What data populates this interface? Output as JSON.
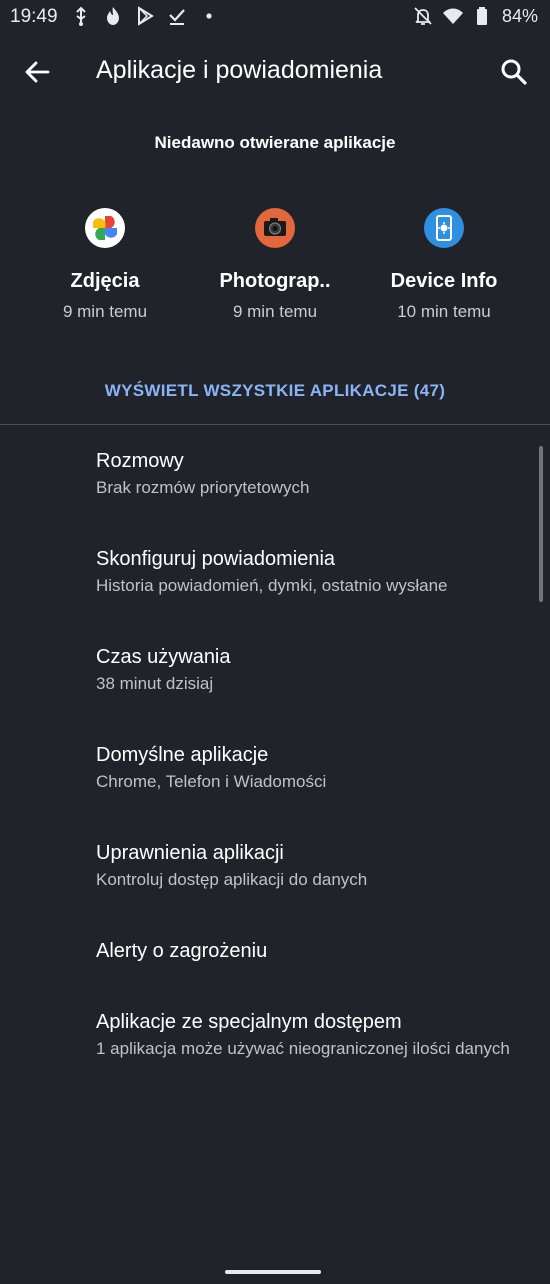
{
  "status_bar": {
    "time": "19:49",
    "battery": "84%",
    "left_icons": [
      "usb-debug-icon",
      "fire-icon",
      "play-store-icon",
      "download-check-icon",
      "dot-icon"
    ],
    "right_icons": [
      "notifications-off-icon",
      "wifi-icon",
      "battery-icon"
    ]
  },
  "app_bar": {
    "title": "Aplikacje i powiadomienia",
    "back_icon": "arrow-back-icon",
    "search_icon": "search-icon"
  },
  "recent": {
    "title": "Niedawno otwierane aplikacje",
    "apps": [
      {
        "name": "Zdjęcia",
        "time": "9 min temu",
        "icon": "google-photos-icon"
      },
      {
        "name": "Photograp..",
        "time": "9 min temu",
        "icon": "camera-app-icon"
      },
      {
        "name": "Device Info",
        "time": "10 min temu",
        "icon": "device-info-icon"
      }
    ],
    "see_all": "WYŚWIETL WSZYSTKIE APLIKACJE (47)"
  },
  "settings": [
    {
      "title": "Rozmowy",
      "subtitle": "Brak rozmów priorytetowych"
    },
    {
      "title": "Skonfiguruj powiadomienia",
      "subtitle": "Historia powiadomień, dymki, ostatnio wysłane"
    },
    {
      "title": "Czas używania",
      "subtitle": "38 minut dzisiaj"
    },
    {
      "title": "Domyślne aplikacje",
      "subtitle": "Chrome, Telefon i Wiadomości"
    },
    {
      "title": "Uprawnienia aplikacji",
      "subtitle": "Kontroluj dostęp aplikacji do danych"
    },
    {
      "title": "Alerty o zagrożeniu",
      "subtitle": ""
    },
    {
      "title": "Aplikacje ze specjalnym dostępem",
      "subtitle": "1 aplikacja może używać nieograniczonej ilości danych"
    }
  ],
  "colors": {
    "background": "#20242a",
    "accent": "#8ab4f8",
    "text_primary": "#ffffff",
    "text_secondary": "#bfc3c8"
  }
}
